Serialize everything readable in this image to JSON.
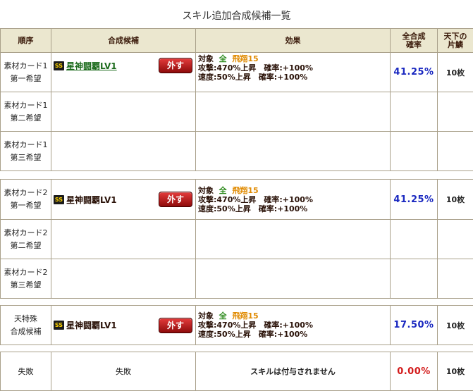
{
  "page_title": "スキル追加合成候補一覧",
  "headers": {
    "order": "順序",
    "candidate": "合成候補",
    "effect": "効果",
    "total_rate_line1": "全合成",
    "total_rate_line2": "確率",
    "piece_line1": "天下の",
    "piece_line2": "片鱗"
  },
  "badge": "SS",
  "remove_label": "外す",
  "effect": {
    "target_label": "対象",
    "target_all": "全",
    "target_unit": "飛翔15",
    "line2": "攻撃:470%上昇　確率:+100%",
    "line3": "速度:50%上昇　確率:+100%"
  },
  "groups": [
    {
      "rows": [
        {
          "order1": "素材カード1",
          "order2": "第一希望",
          "candidate": "星神闘覇LV1",
          "rate": "41.25%",
          "piece": "10枚"
        },
        {
          "order1": "素材カード1",
          "order2": "第二希望"
        },
        {
          "order1": "素材カード1",
          "order2": "第三希望"
        }
      ]
    },
    {
      "rows": [
        {
          "order1": "素材カード2",
          "order2": "第一希望",
          "candidate": "星神闘覇LV1",
          "rate": "41.25%",
          "piece": "10枚"
        },
        {
          "order1": "素材カード2",
          "order2": "第二希望"
        },
        {
          "order1": "素材カード2",
          "order2": "第三希望"
        }
      ]
    },
    {
      "rows": [
        {
          "order1": "天特殊",
          "order2": "合成候補",
          "candidate": "星神闘覇LV1",
          "rate": "17.50%",
          "piece": "10枚"
        }
      ]
    }
  ],
  "failure": {
    "order": "失敗",
    "candidate": "失敗",
    "effect": "スキルは付与されません",
    "rate": "0.00%",
    "piece": "10枚"
  },
  "colors": {
    "header_bg": "#ebe7cf",
    "rate_blue": "#1a28c0",
    "rate_red": "#d31a1a",
    "button_red": "#c0201f"
  }
}
